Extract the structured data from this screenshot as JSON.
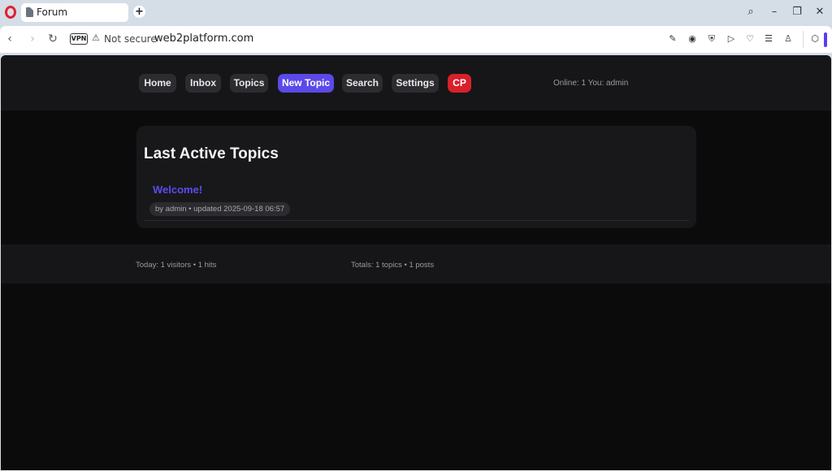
{
  "browser": {
    "tab_title": "Forum",
    "new_tab": "+",
    "vpn_label": "VPN",
    "security_label": "Not secure",
    "url": "web2platform.com"
  },
  "site": {
    "nav": [
      {
        "label": "Home"
      },
      {
        "label": "Inbox"
      },
      {
        "label": "Topics"
      },
      {
        "label": "New Topic"
      },
      {
        "label": "Search"
      },
      {
        "label": "Settings"
      },
      {
        "label": "CP"
      }
    ],
    "online_status": "Online: 1 You: admin",
    "card_title": "Last Active Topics",
    "topics": [
      {
        "title": "Welcome!",
        "meta": "by admin • updated 2025-09-18 06:57"
      }
    ],
    "footer_left": "Today: 1 visitors • 1 hits",
    "footer_right": "Totals: 1 topics • 1 posts"
  },
  "colors": {
    "accent": "#5b49e8",
    "danger": "#d8202a",
    "page_bg": "#0b0b0c"
  }
}
